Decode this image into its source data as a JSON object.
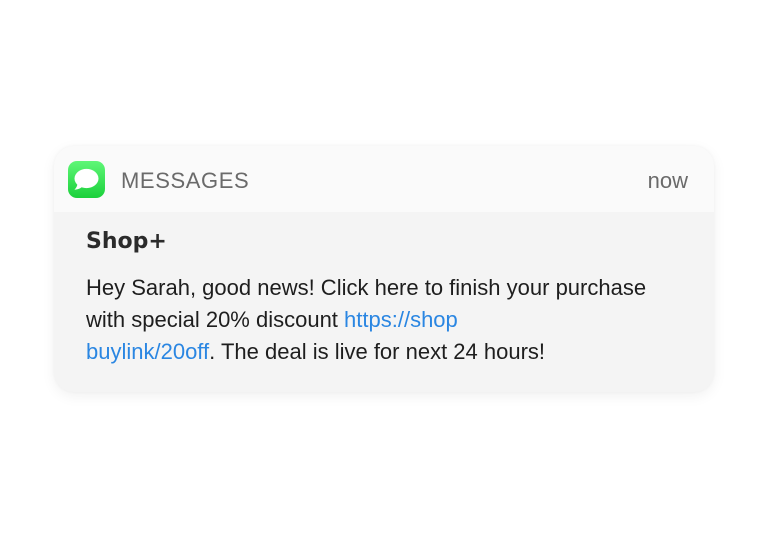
{
  "notification": {
    "app": {
      "name": "MESSAGES",
      "icon": "messages-bubble-icon",
      "icon_color": "#2fd94a"
    },
    "time": "now",
    "sender": "Shop+",
    "message": {
      "text_before_link": "Hey Sarah, good news! Click here to finish your purchase with special 20% discount ",
      "link_line1": "https://shop",
      "link_line2": "buylink/20off",
      "text_after_link": ". The deal is live for next 24 hours!",
      "link_color": "#2a86e2"
    }
  }
}
